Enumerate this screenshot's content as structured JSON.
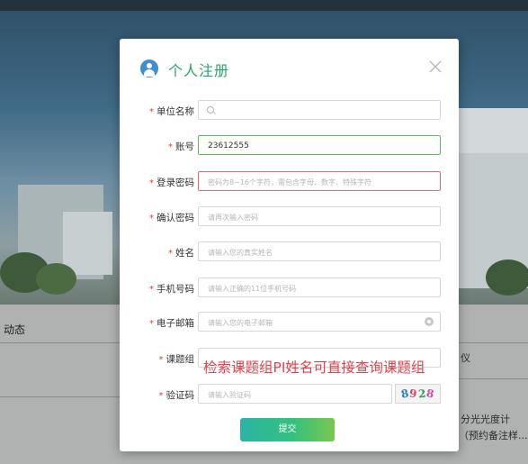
{
  "background": {
    "section_title": "动态",
    "right_items": [
      "仪",
      "分光光度计",
      "（预约备注样..."
    ]
  },
  "modal": {
    "title": "个人注册",
    "fields": [
      {
        "label": "单位名称",
        "value": "",
        "placeholder": ""
      },
      {
        "label": "账号",
        "value": "23612555",
        "placeholder": ""
      },
      {
        "label": "登录密码",
        "value": "",
        "placeholder": "密码为8~16个字符，需包含字母、数字、特殊字符"
      },
      {
        "label": "确认密码",
        "value": "",
        "placeholder": "请再次输入密码"
      },
      {
        "label": "姓名",
        "value": "",
        "placeholder": "请输入您的真实姓名"
      },
      {
        "label": "手机号码",
        "value": "",
        "placeholder": "请输入正确的11位手机号码"
      },
      {
        "label": "电子邮箱",
        "value": "",
        "placeholder": "请输入您的电子邮箱"
      },
      {
        "label": "课题组",
        "value": "",
        "placeholder": ""
      },
      {
        "label": "验证码",
        "value": "",
        "placeholder": "请输入验证码"
      }
    ],
    "required_mark": "*",
    "captcha_text": "8928",
    "overlay_note": "检索课题组PI姓名可直接查询课题组",
    "submit_label": "提交"
  },
  "colors": {
    "title_green": "#28a46b",
    "user_icon_blue": "#3e8ed0",
    "required_red": "#e23a3a",
    "valid_border": "#5cb85c",
    "error_border": "#e06c7c",
    "note_red": "#e2434b"
  },
  "icons": {
    "header": "user-avatar-icon",
    "close": "close-icon",
    "org_search": "search-icon",
    "email_clear": "clear-icon"
  }
}
